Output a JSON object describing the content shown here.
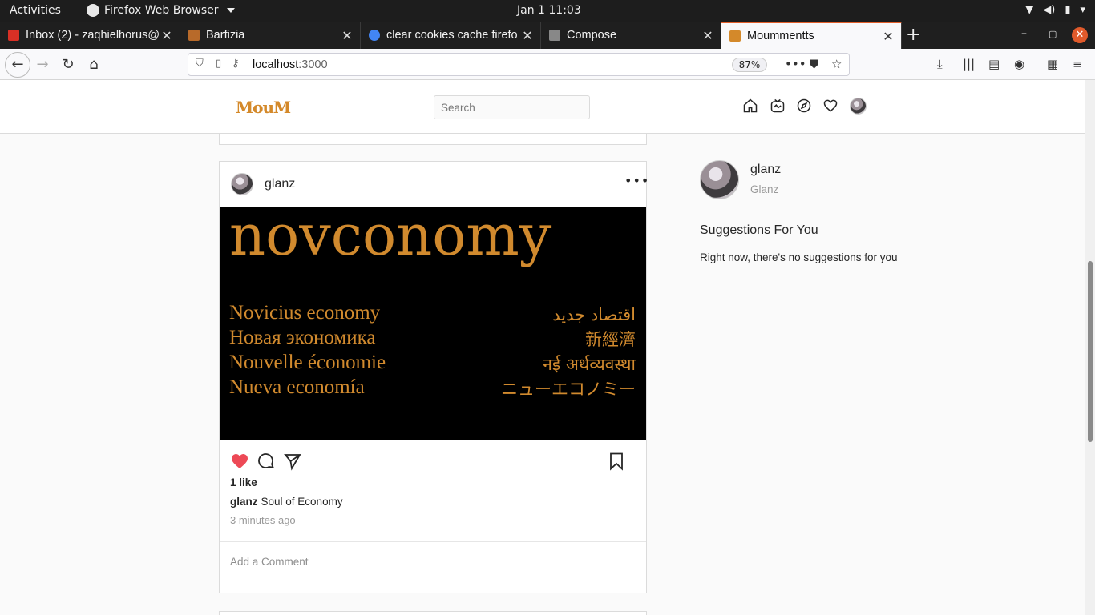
{
  "os": {
    "activities": "Activities",
    "app_name": "Firefox Web Browser",
    "clock": "Jan 1  11:03"
  },
  "browser": {
    "tabs": [
      {
        "title": "Inbox (2) - zaqhielhorus@",
        "favicon_color": "#d93025"
      },
      {
        "title": "Barfizia",
        "favicon_color": "#b86a2a"
      },
      {
        "title": "clear cookies cache firefo",
        "favicon_color": "#4285f4"
      },
      {
        "title": "Compose",
        "favicon_color": "#888888"
      },
      {
        "title": "Moummentts",
        "favicon_color": "#d4892a",
        "active": true
      }
    ],
    "url_host": "localhost",
    "url_port": ":3000",
    "zoom": "87%",
    "accent": "#e25f2a"
  },
  "app": {
    "logo": "MouM",
    "search_placeholder": "Search",
    "nav_icons": [
      "home-icon",
      "inbox-icon",
      "explore-compass-icon",
      "activity-heart-icon",
      "profile-avatar"
    ]
  },
  "post": {
    "username": "glanz",
    "image": {
      "headline": "novconomy",
      "left_lines": [
        "Novicius economy",
        "Новая экономика",
        "Nouvelle économie",
        "Nueva economía"
      ],
      "right_lines": [
        "اقتصاد جديد",
        "新經濟",
        "नई अर्थव्यवस्था",
        "ニューエコノミー"
      ],
      "text_color": "#d18a2e"
    },
    "likes": "1 like",
    "caption_user": "glanz",
    "caption_text": "Soul of Economy",
    "time": "3 minutes ago",
    "comment_placeholder": "Add a Comment",
    "liked": true,
    "like_color": "#ed4956"
  },
  "sidebar": {
    "username": "glanz",
    "fullname": "Glanz",
    "suggestions_title": "Suggestions For You",
    "suggestions_empty": "Right now, there's no suggestions for you"
  }
}
